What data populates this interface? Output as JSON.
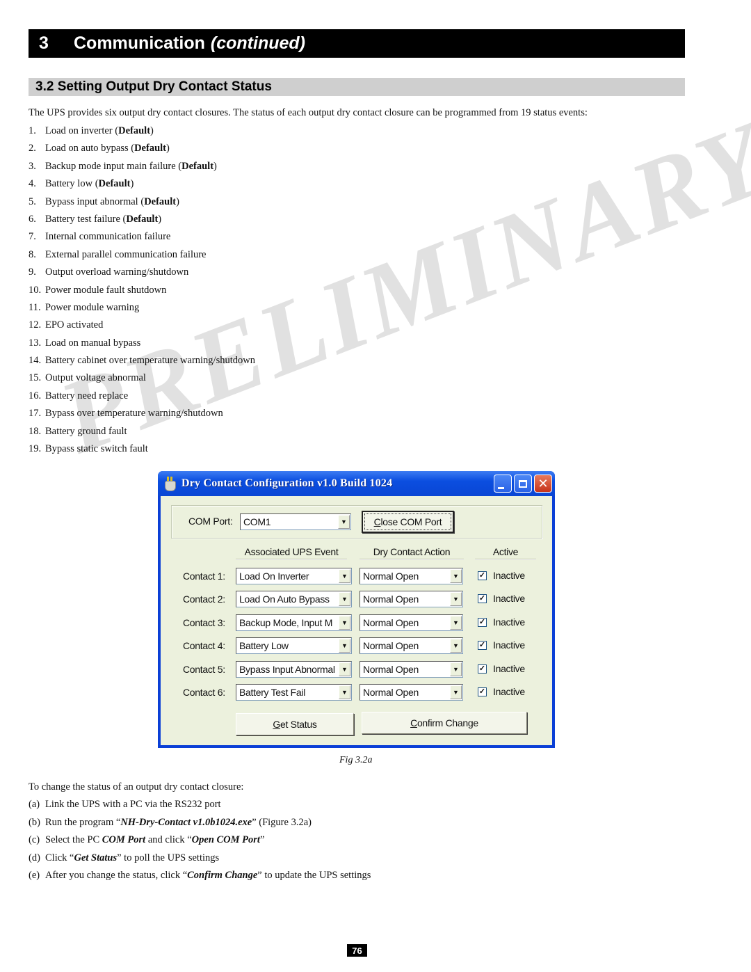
{
  "chapter": {
    "number": "3",
    "title": "Communication",
    "continued": "(continued)"
  },
  "section": {
    "title": "3.2 Setting Output Dry Contact Status"
  },
  "intro": "The UPS provides six output dry contact closures. The status of each output dry contact closure can be programmed from 19 status events:",
  "events": [
    {
      "n": "1.",
      "text": "Load on inverter ",
      "default": "Default"
    },
    {
      "n": "2.",
      "text": "Load on auto bypass ",
      "default": "Default"
    },
    {
      "n": "3.",
      "text": "Backup mode input main failure ",
      "default": "Default"
    },
    {
      "n": "4.",
      "text": "Battery low ",
      "default": "Default"
    },
    {
      "n": "5.",
      "text": "Bypass input abnormal ",
      "default": "Default"
    },
    {
      "n": "6.",
      "text": "Battery test failure ",
      "default": "Default"
    },
    {
      "n": "7.",
      "text": "Internal communication failure"
    },
    {
      "n": "8.",
      "text": "External parallel communication failure"
    },
    {
      "n": "9.",
      "text": "Output overload warning/shutdown"
    },
    {
      "n": "10.",
      "text": "Power module fault shutdown"
    },
    {
      "n": "11.",
      "text": "Power module warning"
    },
    {
      "n": "12.",
      "text": "EPO activated"
    },
    {
      "n": "13.",
      "text": "Load on manual bypass"
    },
    {
      "n": "14.",
      "text": "Battery cabinet over temperature warning/shutdown"
    },
    {
      "n": "15.",
      "text": "Output voltage abnormal"
    },
    {
      "n": "16.",
      "text": "Battery need replace"
    },
    {
      "n": "17.",
      "text": "Bypass over temperature warning/shutdown"
    },
    {
      "n": "18.",
      "text": "Battery ground fault"
    },
    {
      "n": "19.",
      "text": "Bypass static switch fault"
    }
  ],
  "watermark": "PRELIMINARY",
  "window": {
    "title": "Dry Contact Configuration v1.0 Build 1024",
    "com_port_label": "COM Port:",
    "com_port_value": "COM1",
    "close_com_button": {
      "accel": "C",
      "rest": "lose COM Port"
    },
    "headers": {
      "event": "Associated UPS Event",
      "action": "Dry Contact Action",
      "active": "Active"
    },
    "contacts": [
      {
        "label": "Contact 1:",
        "event": "Load On Inverter",
        "action": "Normal Open",
        "active_checked": true,
        "active_label": "Inactive"
      },
      {
        "label": "Contact 2:",
        "event": "Load On Auto Bypass",
        "action": "Normal Open",
        "active_checked": true,
        "active_label": "Inactive"
      },
      {
        "label": "Contact 3:",
        "event": "Backup Mode, Input M",
        "action": "Normal Open",
        "active_checked": true,
        "active_label": "Inactive"
      },
      {
        "label": "Contact 4:",
        "event": "Battery Low",
        "action": "Normal Open",
        "active_checked": true,
        "active_label": "Inactive"
      },
      {
        "label": "Contact 5:",
        "event": "Bypass Input Abnormal",
        "action": "Normal Open",
        "active_checked": true,
        "active_label": "Inactive"
      },
      {
        "label": "Contact 6:",
        "event": "Battery Test Fail",
        "action": "Normal Open",
        "active_checked": true,
        "active_label": "Inactive"
      }
    ],
    "get_status_button": {
      "accel": "G",
      "rest": "et Status"
    },
    "confirm_button": {
      "accel": "C",
      "rest": "onfirm Change"
    }
  },
  "caption": "Fig 3.2a",
  "howto": {
    "lead": "To change the status of an output dry contact closure:",
    "steps": {
      "a": {
        "k": "(a)",
        "text": "Link the UPS with a PC via the RS232 port"
      },
      "b": {
        "k": "(b)",
        "pre": "Run the program “",
        "em": "NH-Dry-Contact v1.0b1024.exe",
        "post": "” (Figure 3.2a)"
      },
      "c": {
        "k": "(c)",
        "pre": "Select the PC ",
        "em": "COM Port",
        "mid": " and click “",
        "em2": "Open COM Port",
        "post": "”"
      },
      "d": {
        "k": "(d)",
        "pre": "Click “",
        "em": "Get Status",
        "post": "” to poll the UPS settings"
      },
      "e": {
        "k": "(e)",
        "pre": "After you change the status, click “",
        "em": "Confirm Change",
        "post": "” to update the UPS settings"
      }
    }
  },
  "page_number": "76"
}
